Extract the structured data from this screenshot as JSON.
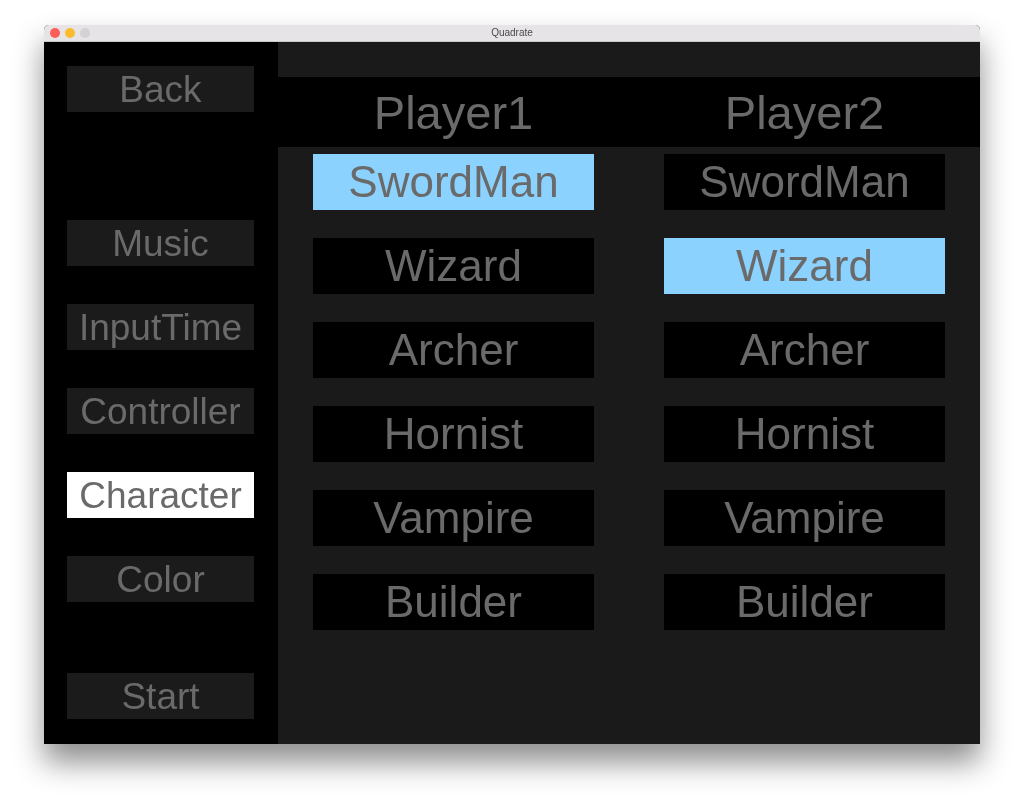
{
  "window": {
    "title": "Quadrate"
  },
  "sidebar": {
    "back_button": {
      "label": "Back"
    },
    "items": [
      {
        "label": "Music",
        "selected": false
      },
      {
        "label": "InputTime",
        "selected": false
      },
      {
        "label": "Controller",
        "selected": false
      },
      {
        "label": "Character",
        "selected": true
      },
      {
        "label": "Color",
        "selected": false
      }
    ],
    "start_button": {
      "label": "Start"
    }
  },
  "players": [
    {
      "heading": "Player1",
      "characters": [
        {
          "label": "SwordMan",
          "selected": true
        },
        {
          "label": "Wizard",
          "selected": false
        },
        {
          "label": "Archer",
          "selected": false
        },
        {
          "label": "Hornist",
          "selected": false
        },
        {
          "label": "Vampire",
          "selected": false
        },
        {
          "label": "Builder",
          "selected": false
        }
      ]
    },
    {
      "heading": "Player2",
      "characters": [
        {
          "label": "SwordMan",
          "selected": false
        },
        {
          "label": "Wizard",
          "selected": true
        },
        {
          "label": "Archer",
          "selected": false
        },
        {
          "label": "Hornist",
          "selected": false
        },
        {
          "label": "Vampire",
          "selected": false
        },
        {
          "label": "Builder",
          "selected": false
        }
      ]
    }
  ]
}
